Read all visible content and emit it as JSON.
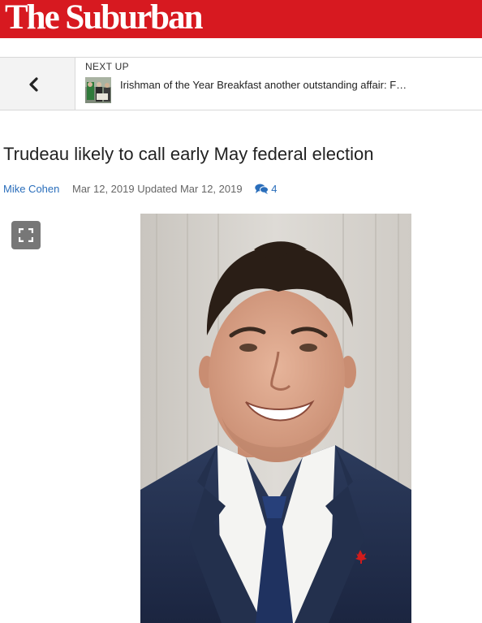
{
  "masthead": {
    "logo_text": "The Suburban",
    "color": "#d71920"
  },
  "next_up": {
    "label": "NEXT UP",
    "title": "Irishman of the Year Breakfast another outstanding affair: F…",
    "back_icon": "chevron-left-icon"
  },
  "article": {
    "headline": "Trudeau likely to call early May federal election",
    "author": "Mike Cohen",
    "dates": "Mar 12, 2019 Updated Mar 12, 2019",
    "comment_count": "4",
    "comment_icon": "comments-icon",
    "fullscreen_icon": "expand-icon"
  },
  "colors": {
    "link": "#2a6ebb",
    "brand_red": "#d71920",
    "meta_gray": "#666666"
  }
}
